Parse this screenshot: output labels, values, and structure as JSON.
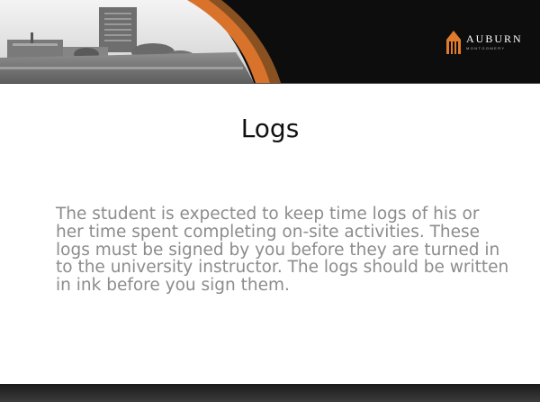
{
  "logo": {
    "name": "AUBURN",
    "subtitle": "MONTGOMERY"
  },
  "slide": {
    "title": "Logs",
    "body": "The student is expected to keep time logs of his or her time spent completing on-site activities. These logs must be signed by you before they are turned in to the university instructor. The logs should be written in ink before you sign them."
  }
}
